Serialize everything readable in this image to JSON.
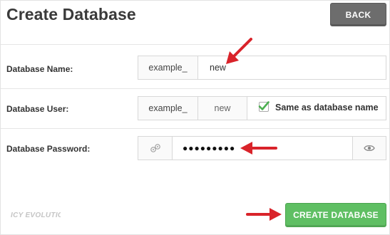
{
  "page": {
    "title": "Create Database"
  },
  "header": {
    "back_label": "BACK"
  },
  "form": {
    "name": {
      "label": "Database Name:",
      "prefix": "example_",
      "value": "new"
    },
    "user": {
      "label": "Database User:",
      "prefix": "example_",
      "value": "new",
      "same_as_label": "Same as database name",
      "same_as_checked": true
    },
    "password": {
      "label": "Database Password:",
      "masked_value": "●●●●●●●●●"
    }
  },
  "footer": {
    "logo_text": "ICY EVOLUTION",
    "create_label": "CREATE DATABASE"
  },
  "icons": {
    "generate_password": "generate-password-icon",
    "show_password": "eye-icon",
    "checkbox": "check-icon"
  },
  "colors": {
    "back_button": "#6d6d6d",
    "create_button": "#5fbf63",
    "annotation_arrow": "#d9232a",
    "checkmark": "#4caf50"
  }
}
